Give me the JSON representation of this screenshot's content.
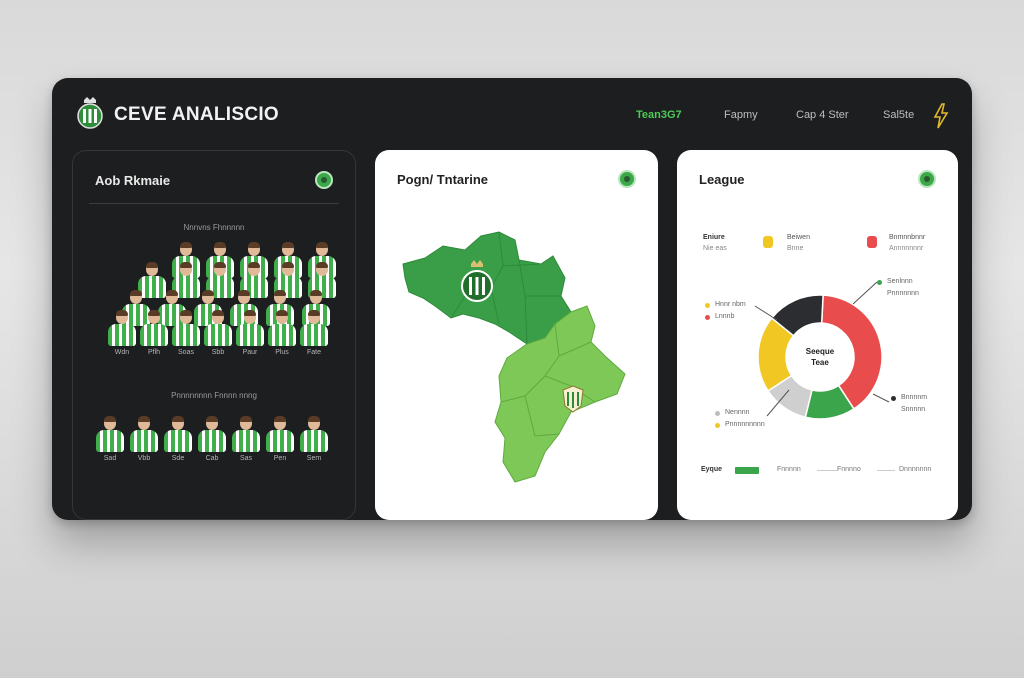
{
  "app": {
    "title": "CEVE ANALISCIO",
    "logo_icon": "club-crest-icon",
    "accent_color": "#4ccb57"
  },
  "nav": [
    {
      "label": "Tean3G7",
      "active": true
    },
    {
      "label": "Fapmy",
      "active": false
    },
    {
      "label": "Cap 4 Ster",
      "active": false
    },
    {
      "label": "Sal5te",
      "active": false
    }
  ],
  "squad_panel": {
    "title": "Aob Rkmaie",
    "section1_label": "Nnnvns Fhnnnnn",
    "section2_label": "Pnnnnnnnn Fnnnn nnng",
    "row1_names": [
      "Wdn",
      "Pflh",
      "Soas",
      "Sbb",
      "Paur",
      "Plus",
      "Fate"
    ],
    "row2_names": [
      "Sad",
      "Vbb",
      "Sde",
      "Cab",
      "Sas",
      "Pen",
      "Sem"
    ]
  },
  "map_panel": {
    "title": "Pogn/ Tntarine",
    "colors": {
      "dark": "#3a9e48",
      "light": "#7dc857"
    }
  },
  "league_panel": {
    "title": "League",
    "top_stats": [
      {
        "label": "Eniure",
        "sub": "Nie eas"
      },
      {
        "label": "Beiwen",
        "sub": "Bnne"
      },
      {
        "label": "Bnmnnbnnr",
        "sub": "Annnnnnnr"
      }
    ],
    "donut_center_line1": "Seeque",
    "donut_center_line2": "Teae",
    "donut_segments": [
      {
        "label": "Red",
        "value": 40,
        "color": "#e84c4c"
      },
      {
        "label": "Green",
        "value": 13,
        "color": "#3aa54a"
      },
      {
        "label": "Grey",
        "value": 12,
        "color": "#cfcfcf"
      },
      {
        "label": "Yellow",
        "value": 20,
        "color": "#f1c823"
      },
      {
        "label": "Dark",
        "value": 15,
        "color": "#2b2d31"
      }
    ],
    "left_legend": [
      {
        "label": "Hnnr nbm",
        "color": "#f1c823"
      },
      {
        "label": "Lnnnb",
        "color": "#e84c4c"
      }
    ],
    "right_top_legend": [
      {
        "label": "Senlnnn",
        "color": "#3aa54a"
      },
      {
        "label": "Pnnnnnnn",
        "color": ""
      }
    ],
    "bottom_left_legend": [
      {
        "label": "Nennnn",
        "color": "#bdbdbd"
      },
      {
        "label": "Pnnnnnnnnn",
        "color": "#f1c823"
      }
    ],
    "bottom_right_legend": [
      {
        "label": "Bnnnnm",
        "color": "#2b2d31"
      },
      {
        "label": "Snnnnn",
        "color": ""
      }
    ],
    "footer": {
      "label": "Eyque",
      "items": [
        "Fnnnnn",
        "Fnnnno",
        "Dnnnnnnn"
      ]
    }
  }
}
